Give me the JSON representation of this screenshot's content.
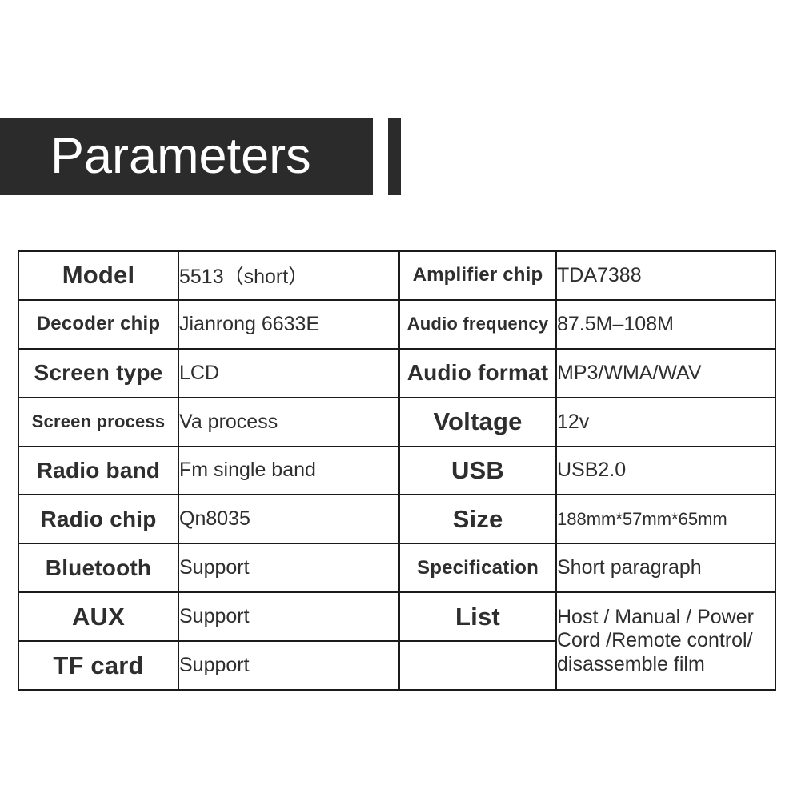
{
  "header": {
    "title": "Parameters",
    "accent_color": "#2b2b2b",
    "title_color": "#ffffff"
  },
  "spec_table": {
    "border_color": "#1b1b1b",
    "text_color": "#2e2e2e",
    "rows": [
      {
        "left_label": "Model",
        "left_value": "5513（short）",
        "right_label": "Amplifier chip",
        "right_value": "TDA7388"
      },
      {
        "left_label": "Decoder chip",
        "left_value": "Jianrong 6633E",
        "right_label": "Audio frequency",
        "right_value": "87.5M–108M"
      },
      {
        "left_label": "Screen type",
        "left_value": "LCD",
        "right_label": "Audio format",
        "right_value": "MP3/WMA/WAV"
      },
      {
        "left_label": "Screen process",
        "left_value": "Va process",
        "right_label": "Voltage",
        "right_value": "12v"
      },
      {
        "left_label": "Radio band",
        "left_value": "Fm single band",
        "right_label": "USB",
        "right_value": "USB2.0"
      },
      {
        "left_label": "Radio chip",
        "left_value": "Qn8035",
        "right_label": "Size",
        "right_value": "188mm*57mm*65mm"
      },
      {
        "left_label": "Bluetooth",
        "left_value": "Support",
        "right_label": "Specification",
        "right_value": "Short paragraph"
      },
      {
        "left_label": "AUX",
        "left_value": "Support",
        "right_label": "List",
        "right_value": "Host / Manual / Power Cord /Remote control/ disassemble film"
      },
      {
        "left_label": "TF card",
        "left_value": "Support",
        "right_label": "",
        "right_value": ""
      }
    ]
  }
}
